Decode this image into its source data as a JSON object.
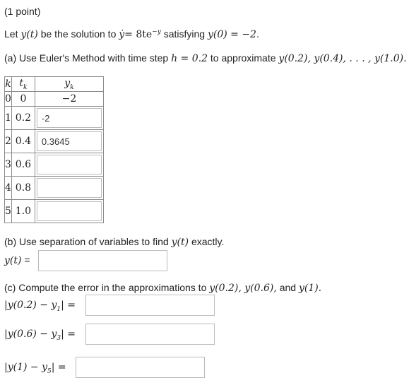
{
  "header": {
    "points": "(1 point)"
  },
  "intro": {
    "prefix": "Let",
    "y_of_t": "y(t)",
    "middle": "be the solution to",
    "ydot": "ẏ",
    "equation_rhs": "= 8te",
    "exponent": "−y",
    "satisfying": "satisfying",
    "initial": "y(0) = −2",
    "end": "."
  },
  "part_a": {
    "prompt": "(a) Use Euler's Method with time step",
    "h_eq": "h = 0.2",
    "to_approx": "to approximate",
    "targets": "y(0.2), y(0.4), . . . , y(1.0)."
  },
  "table": {
    "headers": {
      "k": "k",
      "t": "t",
      "t_sub": "k",
      "y": "y",
      "y_sub": "k"
    },
    "first_row": {
      "k": "0",
      "t": "0",
      "y": "−2"
    },
    "rows": [
      {
        "k": "1",
        "t": "0.2",
        "value": "-2"
      },
      {
        "k": "2",
        "t": "0.4",
        "value": "0.3645"
      },
      {
        "k": "3",
        "t": "0.6",
        "value": ""
      },
      {
        "k": "4",
        "t": "0.8",
        "value": ""
      },
      {
        "k": "5",
        "t": "1.0",
        "value": ""
      }
    ]
  },
  "part_b": {
    "prompt": "(b) Use separation of variables to find",
    "y_of_t": "y(t)",
    "end": "exactly.",
    "label": "y(t)",
    "eq": "=",
    "value": ""
  },
  "part_c": {
    "prompt": "(c) Compute the error in the approximations to",
    "targets": "y(0.2), y(0.6),",
    "and": "and",
    "last": "y(1).",
    "errors": [
      {
        "label": "|y(0.2) − y",
        "sub": "1",
        "close": "| =",
        "value": ""
      },
      {
        "label": "|y(0.6) − y",
        "sub": "3",
        "close": "| =",
        "value": ""
      },
      {
        "label": "|y(1) − y",
        "sub": "5",
        "close": "| =",
        "value": ""
      }
    ]
  }
}
